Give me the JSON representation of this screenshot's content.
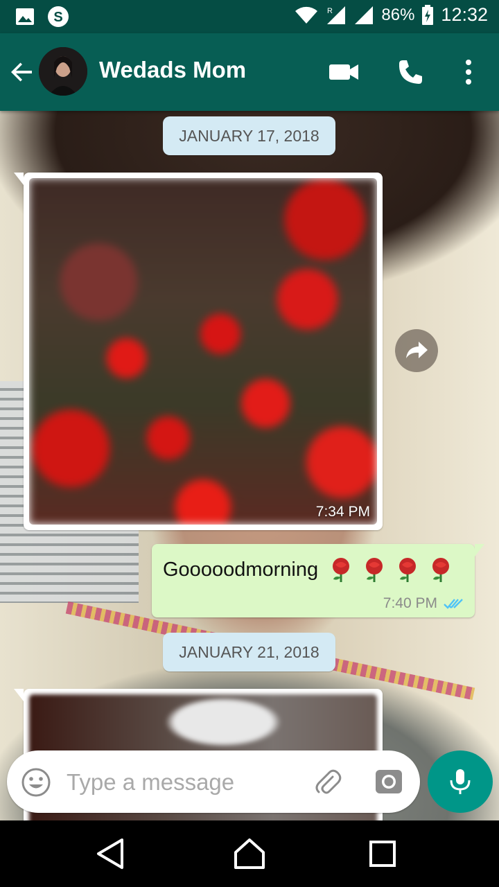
{
  "status_bar": {
    "battery_percent": "86%",
    "time": "12:32",
    "icons": [
      "gallery-icon",
      "skype-icon",
      "wifi-icon",
      "signal-roaming-icon",
      "signal-icon",
      "battery-charging-icon"
    ]
  },
  "header": {
    "contact_name": "Wedads Mom",
    "icons": [
      "back-arrow-icon",
      "avatar",
      "video-call-icon",
      "voice-call-icon",
      "more-options-icon"
    ]
  },
  "messages": [
    {
      "type": "date",
      "text": "JANUARY 17, 2018"
    },
    {
      "type": "incoming-image",
      "time": "7:34 PM"
    },
    {
      "type": "outgoing-text",
      "text": "Gooooodmorning",
      "emoji": "rose x4",
      "time": "7:40 PM",
      "status": "read"
    },
    {
      "type": "date",
      "text": "JANUARY 21, 2018"
    },
    {
      "type": "incoming-image",
      "time": ""
    }
  ],
  "composer": {
    "placeholder": "Type a message",
    "icons": [
      "emoji-icon",
      "attach-icon",
      "camera-icon",
      "mic-icon"
    ]
  },
  "colors": {
    "header": "#075e54",
    "status_bar": "#054d44",
    "outgoing_bubble": "#dcf8c6",
    "date_chip": "#d4eaf4",
    "fab": "#009688",
    "read_ticks": "#4fc3f7"
  }
}
